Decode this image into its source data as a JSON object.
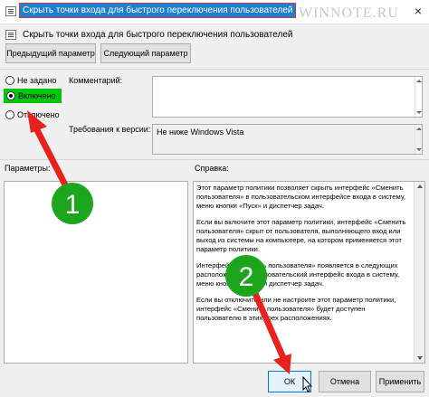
{
  "window": {
    "title": "Скрыть точки входа для быстрого переключения пользователей",
    "watermark": "WINNOTE.RU",
    "close_glyph": "×"
  },
  "header": {
    "title": "Скрыть точки входа для быстрого переключения пользователей",
    "icon": "policy-icon"
  },
  "nav": {
    "prev_label": "Предыдущий параметр",
    "next_label": "Следующий параметр"
  },
  "state": {
    "options": [
      {
        "label": "Не задано",
        "checked": false
      },
      {
        "label": "Включено",
        "checked": true
      },
      {
        "label": "Отключено",
        "checked": false
      }
    ]
  },
  "fields": {
    "comment_label": "Комментарий:",
    "comment_value": "",
    "supported_label": "Требования к версии:",
    "supported_value": "Не ниже Windows Vista"
  },
  "panels": {
    "params_label": "Параметры:",
    "help_label": "Справка:",
    "help_paragraphs": [
      "Этот параметр политики позволяет скрыть интерфейс «Сменить пользователя» в пользовательском интерфейсе входа в систему, меню кнопки «Пуск» и диспетчер задач.",
      "Если вы включите этот параметр политики, интерфейс «Сменить пользователя» скрыт от пользователя, выполняющего вход или выход из системы на компьютере, на котором применяется этот параметр политики.",
      "Интерфейс «Сменить пользователя» появляется в следующих расположениях: пользовательский интерфейс входа в систему, меню кнопки «Пуск» и диспетчер задач.",
      "Если вы отключите или не настроите этот параметр политики, интерфейс «Сменить пользователя» будет доступен пользователю в этих трех расположениях."
    ]
  },
  "footer": {
    "ok_label": "ОК",
    "cancel_label": "Отмена",
    "apply_label": "Применить"
  },
  "annotations": {
    "step1": "1",
    "step2": "2",
    "badge_color": "#1ea51e",
    "arrow_color": "#e8211c",
    "highlight_color": "#00c70c"
  }
}
